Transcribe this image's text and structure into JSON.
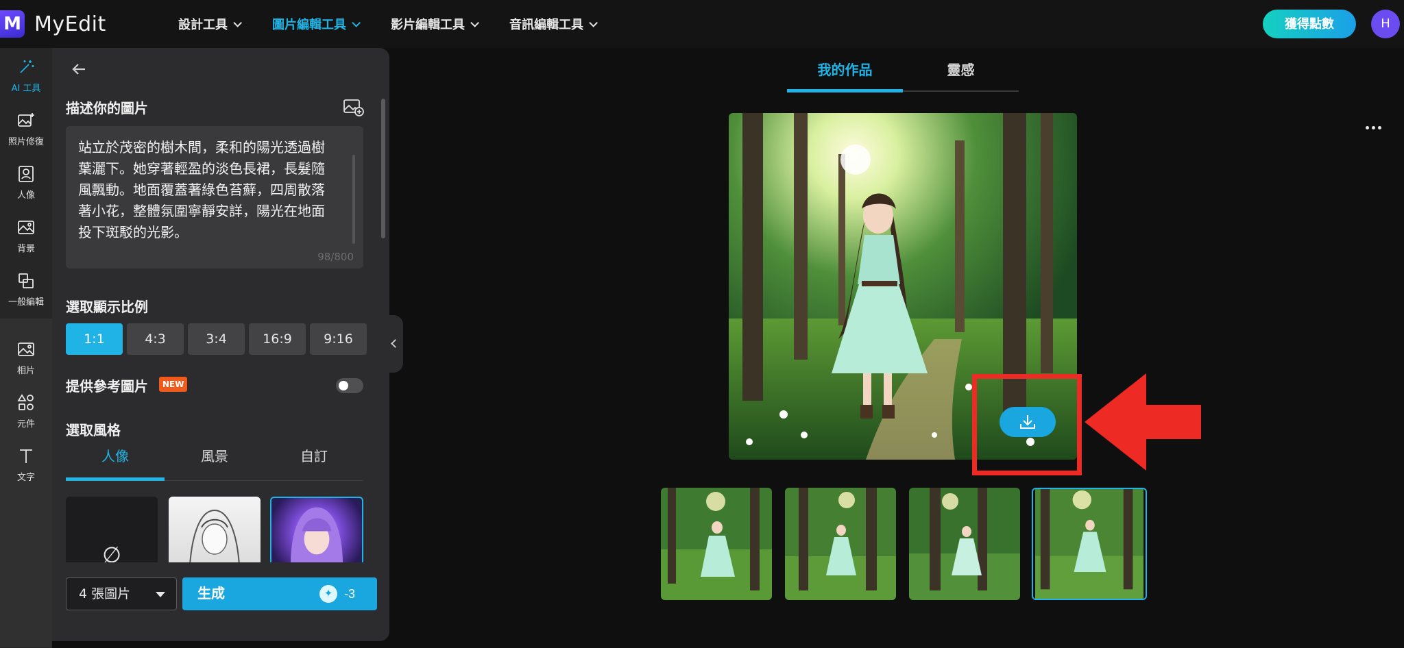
{
  "brand": {
    "logo_letter": "M",
    "name": "MyEdit"
  },
  "nav": {
    "items": [
      {
        "label": "設計工具",
        "active": false
      },
      {
        "label": "圖片編輯工具",
        "active": true
      },
      {
        "label": "影片編輯工具",
        "active": false
      },
      {
        "label": "音訊編輯工具",
        "active": false
      }
    ],
    "points_label": "獲得點數",
    "avatar_initial": "H"
  },
  "rail": {
    "items": [
      {
        "label": "AI 工具",
        "icon": "magic-wand-icon",
        "active": true
      },
      {
        "label": "照片修復",
        "icon": "image-sparkle-icon"
      },
      {
        "label": "人像",
        "icon": "portrait-icon"
      },
      {
        "label": "背景",
        "icon": "background-icon"
      },
      {
        "label": "一般編輯",
        "icon": "crop-icon"
      },
      {
        "label": "相片",
        "icon": "photo-icon"
      },
      {
        "label": "元件",
        "icon": "shapes-icon"
      },
      {
        "label": "文字",
        "icon": "text-icon"
      }
    ]
  },
  "panel": {
    "describe_title": "描述你的圖片",
    "prompt_text": "站立於茂密的樹木間，柔和的陽光透過樹葉灑下。她穿著輕盈的淡色長裙，長髮隨風飄動。地面覆蓋著綠色苔蘚，四周散落著小花，整體氛圍寧靜安詳，陽光在地面投下斑駁的光影。",
    "prompt_count": "98/800",
    "ratio_title": "選取顯示比例",
    "ratios": [
      "1:1",
      "4:3",
      "3:4",
      "16:9",
      "9:16"
    ],
    "reference_title": "提供參考圖片",
    "new_badge": "NEW",
    "style_title": "選取風格",
    "style_tabs": [
      "人像",
      "風景",
      "自訂"
    ],
    "none_symbol": "∅",
    "count_value": "4 張圖片",
    "generate_label": "生成",
    "generate_cost": "-3"
  },
  "main": {
    "tabs": [
      "我的作品",
      "靈感"
    ]
  },
  "colors": {
    "accent": "#1fb3e6",
    "highlight": "#ee2a24",
    "brand": "#6d4cff"
  }
}
